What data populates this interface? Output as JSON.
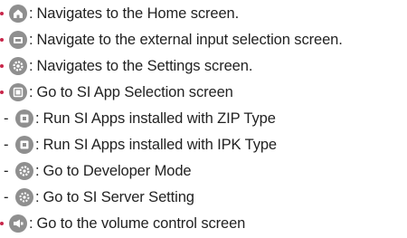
{
  "items": [
    {
      "icon": "home-icon",
      "text": "Navigates to the Home screen."
    },
    {
      "icon": "external-input-icon",
      "text": "Navigate to the external input selection screen."
    },
    {
      "icon": "settings-icon",
      "text": "Navigates to the Settings screen."
    },
    {
      "icon": "si-app-icon",
      "text": "Go to SI App Selection screen"
    },
    {
      "icon": "zip-app-icon",
      "text": "Run SI Apps installed with ZIP Type"
    },
    {
      "icon": "ipk-app-icon",
      "text": "Run SI Apps installed with IPK Type"
    },
    {
      "icon": "developer-mode-icon",
      "text": "Go to Developer Mode"
    },
    {
      "icon": "si-server-icon",
      "text": "Go to SI Server Setting"
    },
    {
      "icon": "volume-icon",
      "text": "Go to the volume control screen"
    }
  ],
  "separator": ":",
  "sub_marker": "-",
  "colors": {
    "bullet": "#c8264a",
    "icon": "#8f8f8f",
    "text": "#222222"
  }
}
